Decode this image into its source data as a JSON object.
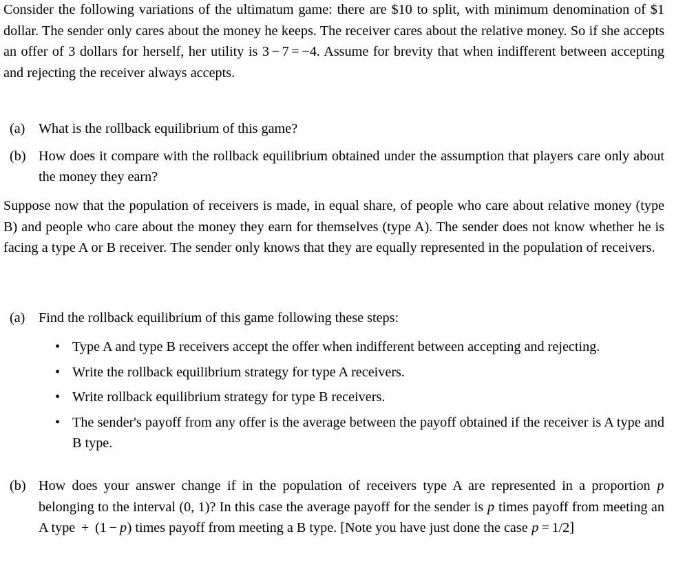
{
  "document": {
    "type": "problem-set",
    "subject": "ultimatum game variations",
    "text_color": "#000000",
    "background_color": "#ffffff"
  },
  "intro_paragraph": {
    "full_text": "Consider the following variations of the ultimatum game: there are $10 to split, with minimum denomination of $1 dollar. The sender only cares about the money he keeps. The receiver cares about the relative money. So if she accepts an offer of 3 dollars for herself, her utility is 3 − 7 = −4. Assume for brevity that when indifferent between accepting and rejecting the receiver always accepts.",
    "segment_1": "Consider the following variations of the ultimatum game: there are $10 to split, with minimum denomination of $1 dollar. The sender only cares about the money he keeps. The receiver cares about the relative money. So if she accepts an offer of 3 dollars for herself, her utility is ",
    "math_expression": "3 − 7 = −4",
    "math_lhs": "3",
    "math_minus": "−",
    "math_rhs": "7",
    "math_equals": "=",
    "math_result": "−4",
    "segment_2": ". Assume for brevity that when indifferent between accepting and rejecting the receiver always accepts."
  },
  "first_question_list": {
    "items": [
      {
        "label": "(a)",
        "text": "What is the rollback equilibrium of this game?"
      },
      {
        "label": "(b)",
        "text": "How does it compare with the rollback equilibrium obtained under the assumption that players care only about the money they earn?"
      }
    ]
  },
  "second_paragraph": {
    "text": "Suppose now that the population of receivers is made, in equal share, of people who care about relative money (type B) and people who care about the money they earn for themselves (type A). The sender does not know whether he is facing a type A or B receiver. The sender only knows that they are equally represented in the population of receivers."
  },
  "second_question_list": {
    "item_a": {
      "label": "(a)",
      "text": "Find the rollback equilibrium of this game following these steps:"
    },
    "bullets": [
      {
        "marker": "•",
        "text": "Type A and type B receivers accept the offer when indifferent between accepting and rejecting."
      },
      {
        "marker": "•",
        "text": "Write the rollback equilibrium strategy for type A receivers."
      },
      {
        "marker": "•",
        "text": "Write rollback equilibrium strategy for type B receivers."
      },
      {
        "marker": "•",
        "text": "The sender's payoff from any offer is the average between the payoff obtained if the receiver is A type and B type."
      }
    ],
    "item_b": {
      "label": "(b)",
      "seg_1": "How does your answer change if in the population of receivers type A are represented in a proportion ",
      "var_p_1": "p",
      "seg_2": " belonging to the interval ",
      "interval": "(0, 1)",
      "seg_3": "? In this case the average payoff for the sender is ",
      "var_p_2": "p",
      "seg_4": " times payoff from meeting an A type ",
      "plus": "+",
      "seg_5": " ",
      "expr_open": "(1",
      "expr_minus": "−",
      "var_p_3": "p",
      "expr_close": ")",
      "seg_6": " times payoff from meeting a B type. [Note you have just done the case ",
      "var_p_4": "p",
      "eq_sign": "=",
      "fraction": "1/2",
      "seg_7": "]"
    }
  }
}
